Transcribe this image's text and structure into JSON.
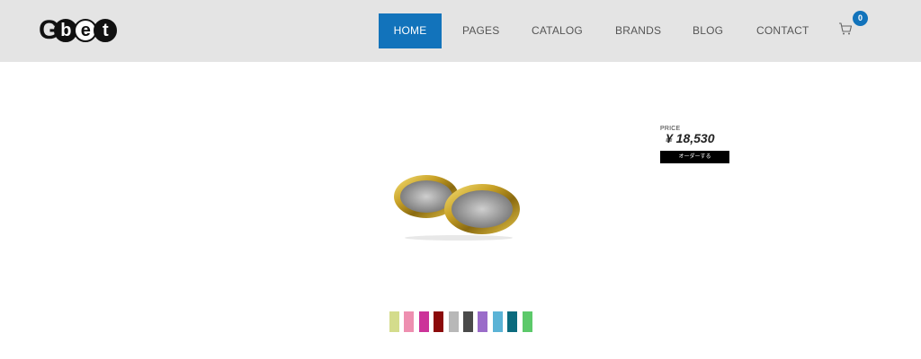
{
  "header": {
    "logo": {
      "letters": [
        "G",
        "b",
        "e",
        "t"
      ],
      "text": "Gbet"
    },
    "nav": [
      {
        "label": "HOME",
        "active": true
      },
      {
        "label": "PAGES",
        "active": false
      },
      {
        "label": "CATALOG",
        "active": false
      },
      {
        "label": "BRANDS",
        "active": false
      },
      {
        "label": "BLOG",
        "active": false
      },
      {
        "label": "CONTACT",
        "active": false
      }
    ],
    "cart": {
      "icon": "cart-icon",
      "count": "0"
    }
  },
  "product": {
    "image": "gold-rings",
    "price_label": "PRICE",
    "price": "¥ 18,530",
    "order_label": "オーダーする"
  },
  "colors": {
    "accent": "#1273bb",
    "header_bg": "#e4e4e4",
    "swatches": [
      "#d4dc8c",
      "#ee8fb0",
      "#cc3399",
      "#8b0a0a",
      "#b8b8b8",
      "#4a4a4a",
      "#9a6cc9",
      "#5bb3d6",
      "#0b6b7e",
      "#5cc96a"
    ]
  }
}
